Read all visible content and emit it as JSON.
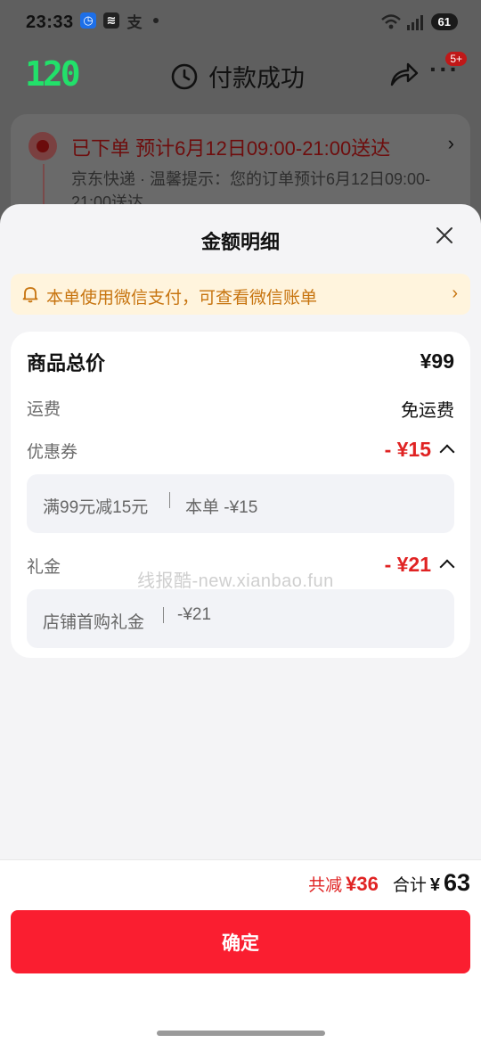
{
  "status_bar": {
    "time": "23:33",
    "battery": "61",
    "app_icons": [
      "alarm-app-icon",
      "stack-app-icon",
      "alipay-icon"
    ]
  },
  "nav": {
    "logo": "120",
    "title": "付款成功",
    "badge": "5+"
  },
  "order": {
    "status": "已下单  预计6月12日09:00-21:00送达",
    "tip": "京东快递 · 温馨提示：您的订单预计6月12日09:00-21:00送达"
  },
  "sheet": {
    "title": "金额明细",
    "notice": "本单使用微信支付，可查看微信账单",
    "items": {
      "goods_total_label": "商品总价",
      "goods_total_value": "¥99",
      "shipping_label": "运费",
      "shipping_value": "免运费",
      "coupon_label": "优惠券",
      "coupon_value": "- ¥15",
      "coupon_detail_name": "满99元减15元",
      "coupon_detail_amount": "本单 -¥15",
      "gift_label": "礼金",
      "gift_value": "- ¥21",
      "gift_detail_name": "店铺首购礼金",
      "gift_detail_amount": "-¥21"
    },
    "watermark": "线报酷-new.xianbao.fun"
  },
  "footer": {
    "reduce_label": "共减",
    "reduce_value": "¥36",
    "total_label": "合计",
    "total_currency": "¥",
    "total_value": "63",
    "confirm": "确定"
  },
  "colors": {
    "accent_red": "#fa1e30",
    "discount_red": "#e02323",
    "notice_bg": "#fff4dd",
    "notice_text": "#c7740f"
  }
}
